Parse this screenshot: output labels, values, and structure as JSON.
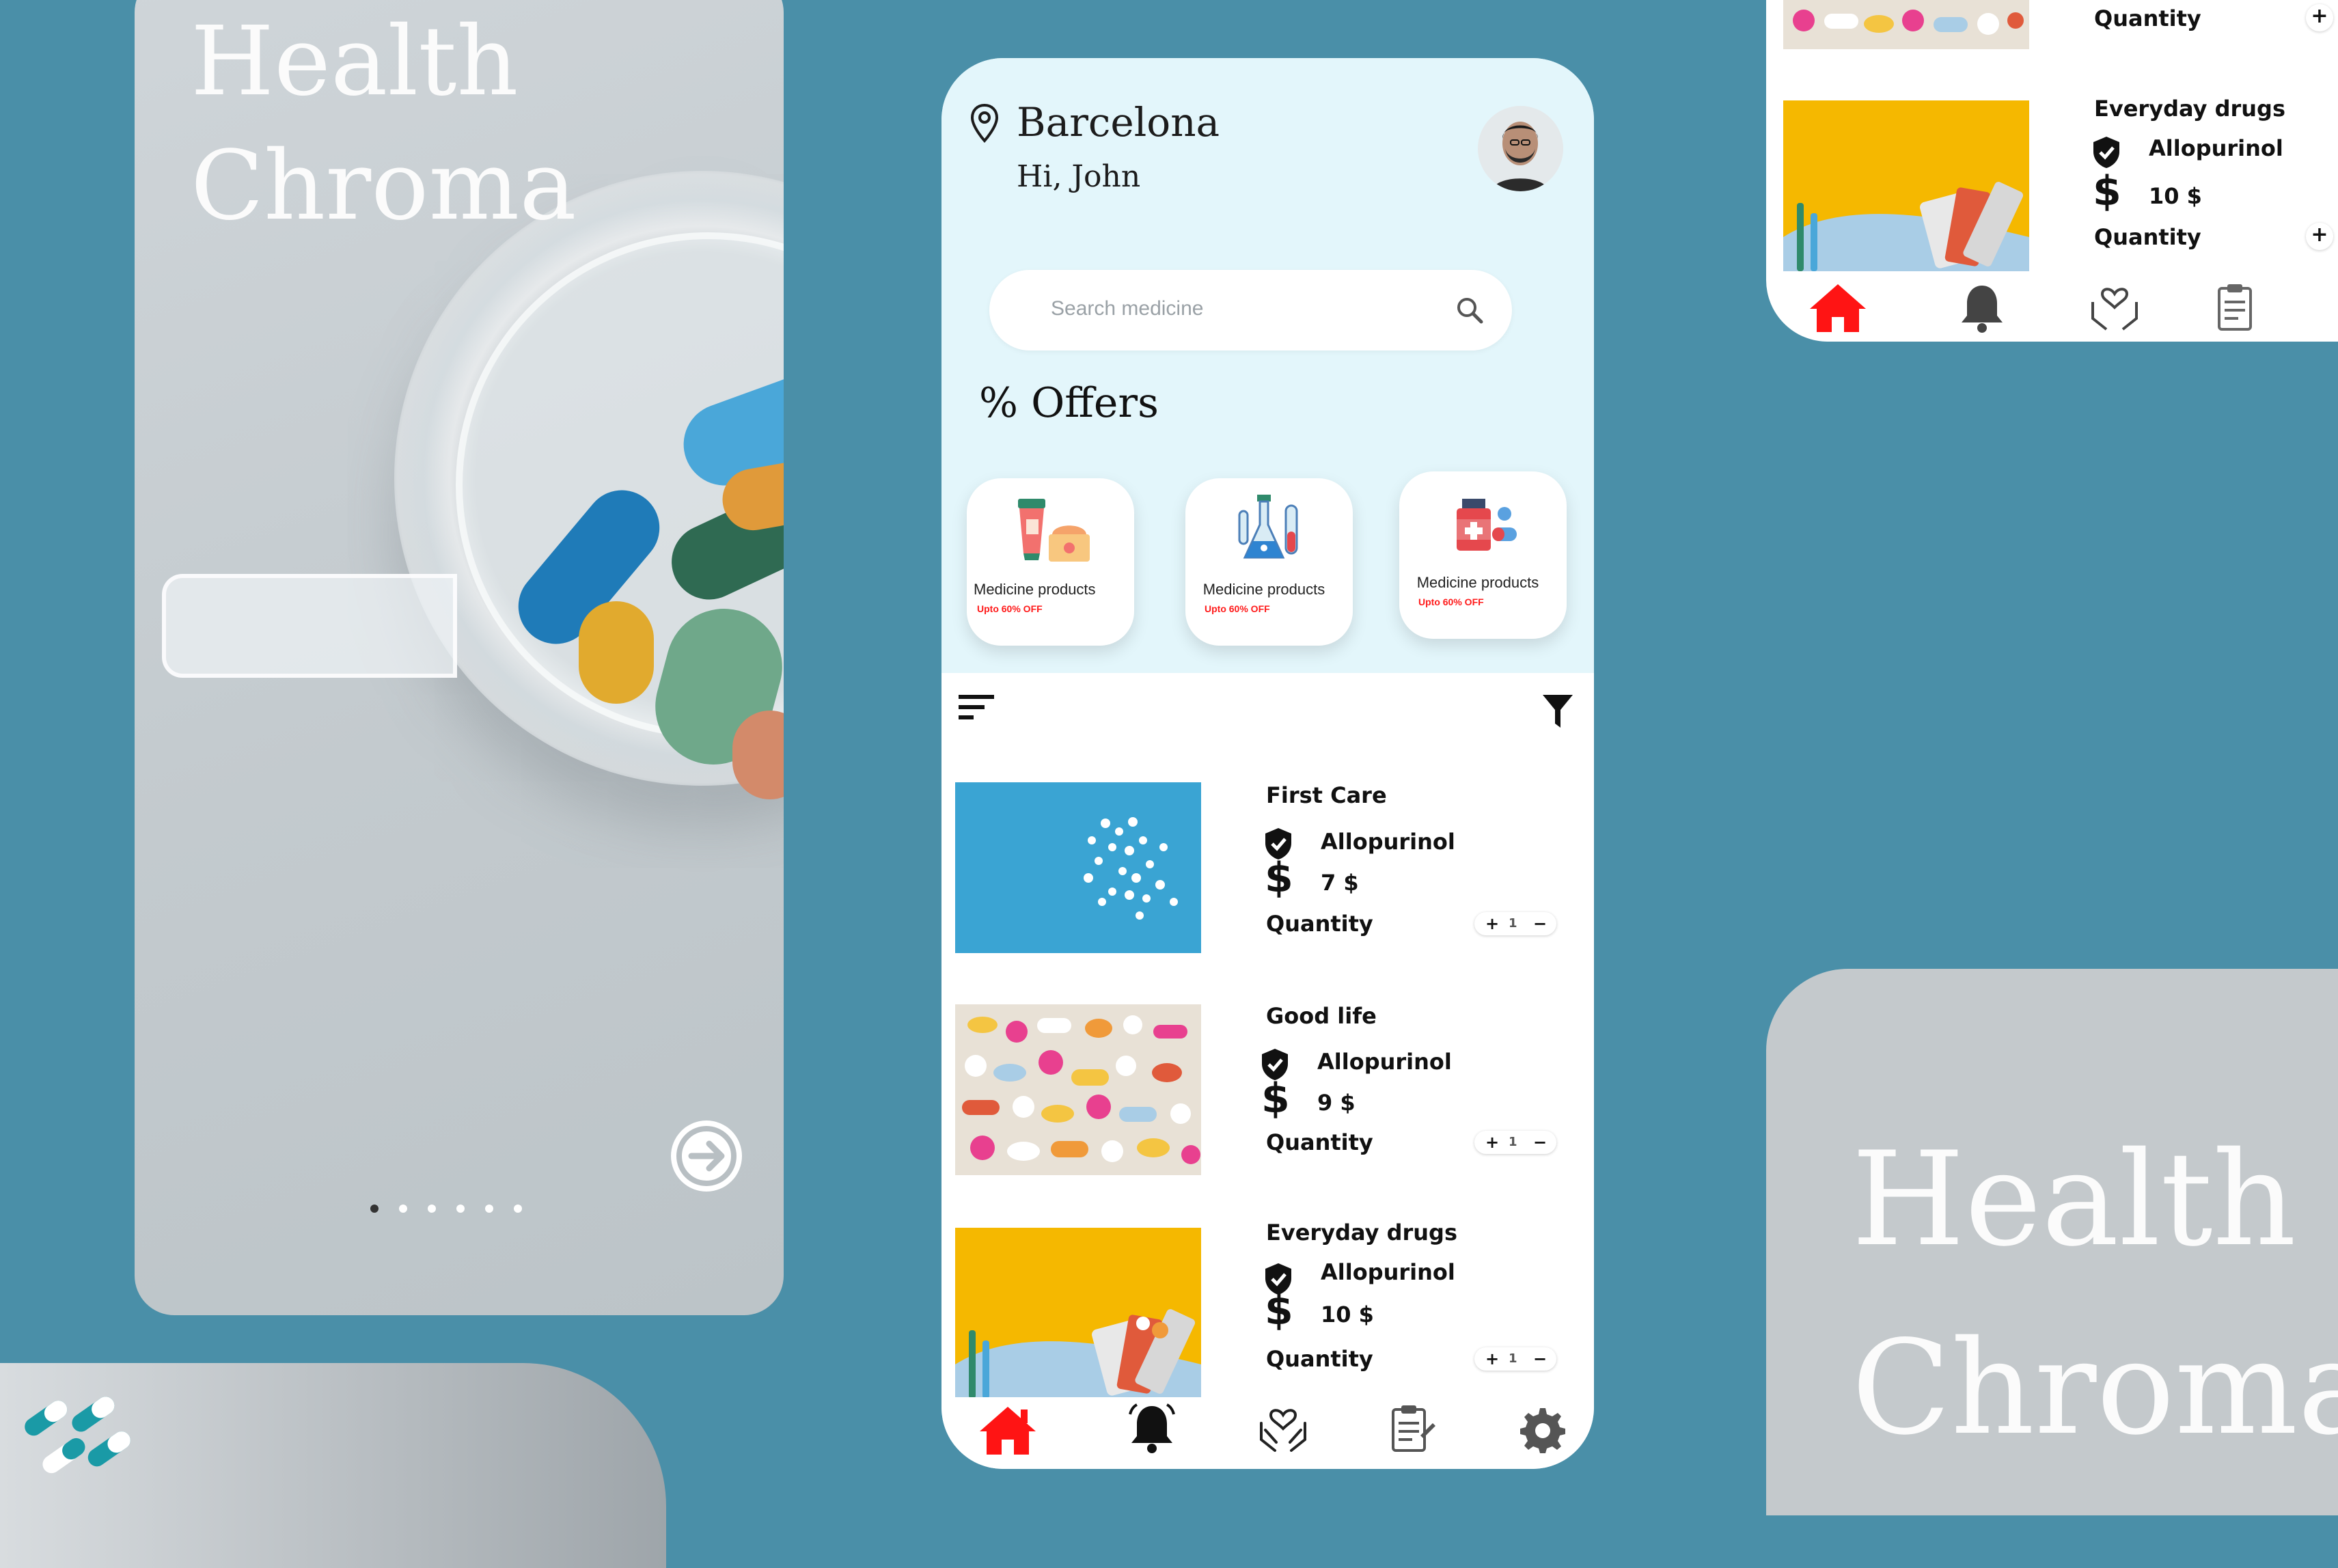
{
  "splash": {
    "title_line1": "Health",
    "title_line2": "Chroma",
    "page_dots": 6,
    "active_dot": 1
  },
  "phone": {
    "location": "Barcelona",
    "greeting": "Hi, John",
    "search_placeholder": "Search medicine",
    "offers_title": "Offers",
    "offers_symbol": "%",
    "offers": [
      {
        "name": "Medicine products",
        "discount": "Upto 60% OFF"
      },
      {
        "name": "Medicine products",
        "discount": "Upto 60% OFF"
      },
      {
        "name": "Medicine products",
        "discount": "Upto 60% OFF"
      }
    ],
    "products": [
      {
        "brand": "First Care",
        "drug": "Allopurinol",
        "price": "7 $",
        "quantity_label": "Quantity",
        "quantity": "1"
      },
      {
        "brand": "Good life",
        "drug": "Allopurinol",
        "price": "9 $",
        "quantity_label": "Quantity",
        "quantity": "1"
      },
      {
        "brand": "Everyday drugs",
        "drug": "Allopurinol",
        "price": "10 $",
        "quantity_label": "Quantity",
        "quantity": "1"
      }
    ],
    "stepper_plus": "+",
    "stepper_minus": "−",
    "currency_symbol": "$",
    "nav": [
      "home-icon",
      "bell-icon",
      "heart-hands-icon",
      "clipboard-icon",
      "gear-icon"
    ],
    "active_nav_color": "#ff1414"
  },
  "topright": {
    "quantity_label": "Quantity",
    "brand": "Everyday drugs",
    "drug": "Allopurinol",
    "price": "10 $",
    "quantity_label2": "Quantity",
    "plus": "+",
    "currency_symbol": "$"
  },
  "bottomright": {
    "title_line1": "Health",
    "title_line2": "Chroma"
  },
  "colors": {
    "background": "#4a8fa8",
    "phone_top": "#e3f6fb",
    "accent_red": "#ff1414"
  }
}
